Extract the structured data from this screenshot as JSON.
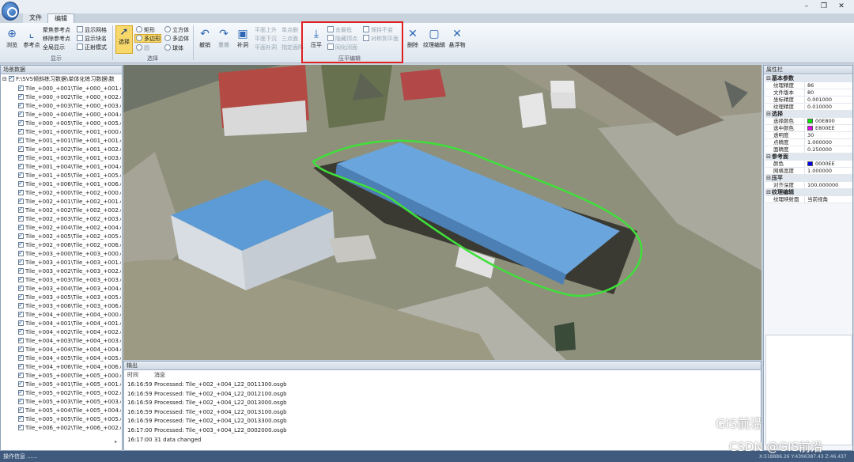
{
  "tabs": [
    {
      "label": "文件"
    },
    {
      "label": "编辑"
    }
  ],
  "window_controls": {
    "min": "–",
    "max": "❐",
    "close": "✕"
  },
  "ribbon": {
    "browse": "浏览",
    "ref_point": "参考点",
    "gather_ref": "聚焦参考点",
    "move_ref": "移除参考点",
    "global_show": "全局显示",
    "show_grid": "显示网格",
    "show_block": "显示块名",
    "orthographic": "正射模式",
    "group_display": "显示",
    "select": "选择",
    "rect": "矩形",
    "polygon": "多边形",
    "circle": "圆",
    "cube": "立方体",
    "polyhedron": "多边体",
    "sphere": "球体",
    "group_select": "选择",
    "undo": "撤销",
    "redo": "重做",
    "patch": "补洞",
    "smooth_up": "平面上升",
    "smooth_down": "平面下沉",
    "smooth_patch": "平面补洞",
    "delete_one": "单点删",
    "tri_one": "三点面",
    "project_down": "指定面降",
    "flatten": "压平",
    "keep_min": "去最低",
    "hide_vertex": "隐藏顶点",
    "preserve": "保持不变",
    "mirror_plane": "对称到平面",
    "lod_same": "同化闭面",
    "group_flatten": "压平编辑",
    "del": "删除",
    "texture_edit": "纹理编辑",
    "float": "悬浮物"
  },
  "left_panel": {
    "title": "场景数据",
    "root": "F:\\SVS倾斜练习数据\\单体化练习数据\\数",
    "items": [
      "Tile_+000_+001\\Tile_+000_+001.os",
      "Tile_+000_+002\\Tile_+000_+002.os",
      "Tile_+000_+003\\Tile_+000_+003.os",
      "Tile_+000_+004\\Tile_+000_+004.os",
      "Tile_+000_+005\\Tile_+000_+005.os",
      "Tile_+001_+000\\Tile_+001_+000.os",
      "Tile_+001_+001\\Tile_+001_+001.os",
      "Tile_+001_+002\\Tile_+001_+002.os",
      "Tile_+001_+003\\Tile_+001_+003.os",
      "Tile_+001_+004\\Tile_+001_+004.os",
      "Tile_+001_+005\\Tile_+001_+005.os",
      "Tile_+001_+006\\Tile_+001_+006.os",
      "Tile_+002_+000\\Tile_+002_+000.os",
      "Tile_+002_+001\\Tile_+002_+001.os",
      "Tile_+002_+002\\Tile_+002_+002.os",
      "Tile_+002_+003\\Tile_+002_+003.os",
      "Tile_+002_+004\\Tile_+002_+004.os",
      "Tile_+002_+005\\Tile_+002_+005.os",
      "Tile_+002_+006\\Tile_+002_+006.os",
      "Tile_+003_+000\\Tile_+003_+000.os",
      "Tile_+003_+001\\Tile_+003_+001.os",
      "Tile_+003_+002\\Tile_+003_+002.os",
      "Tile_+003_+003\\Tile_+003_+003.os",
      "Tile_+003_+004\\Tile_+003_+004.os",
      "Tile_+003_+005\\Tile_+003_+005.os",
      "Tile_+003_+006\\Tile_+003_+006.os",
      "Tile_+004_+000\\Tile_+004_+000.os",
      "Tile_+004_+001\\Tile_+004_+001.os",
      "Tile_+004_+002\\Tile_+004_+002.os",
      "Tile_+004_+003\\Tile_+004_+003.os",
      "Tile_+004_+004\\Tile_+004_+004.os",
      "Tile_+004_+005\\Tile_+004_+005.os",
      "Tile_+004_+006\\Tile_+004_+006.os",
      "Tile_+005_+000\\Tile_+005_+000.os",
      "Tile_+005_+001\\Tile_+005_+001.os",
      "Tile_+005_+002\\Tile_+005_+002.os",
      "Tile_+005_+003\\Tile_+005_+003.os",
      "Tile_+005_+004\\Tile_+005_+004.os",
      "Tile_+005_+005\\Tile_+005_+005.os",
      "Tile_+006_+002\\Tile_+006_+002.os"
    ]
  },
  "right_panel": {
    "title": "属性栏",
    "sections": [
      {
        "name": "基本参数",
        "rows": [
          {
            "k": "纹理精度",
            "v": "86"
          },
          {
            "k": "文件版本",
            "v": "80"
          },
          {
            "k": "坐标精度",
            "v": "0.001000"
          },
          {
            "k": "纹理精度",
            "v": "0.010000"
          }
        ]
      },
      {
        "name": "选择",
        "rows": [
          {
            "k": "选择颜色",
            "v": "00E800",
            "color": "#00e800"
          },
          {
            "k": "选中颜色",
            "v": "E800EE",
            "color": "#e800ee"
          },
          {
            "k": "透明度",
            "v": "30"
          },
          {
            "k": "点精度",
            "v": "1.000000"
          },
          {
            "k": "面精度",
            "v": "0.250000"
          }
        ]
      },
      {
        "name": "参考面",
        "rows": [
          {
            "k": "颜色",
            "v": "0000EE",
            "color": "#0000ee"
          },
          {
            "k": "网格宽度",
            "v": "1.000000"
          }
        ]
      },
      {
        "name": "压平",
        "rows": [
          {
            "k": "对齐深度",
            "v": "100.000000"
          }
        ]
      },
      {
        "name": "纹理编辑",
        "rows": [
          {
            "k": "纹理映射面",
            "v": "当前视角"
          }
        ]
      }
    ]
  },
  "output": {
    "title": "输出",
    "col_time": "时间",
    "col_msg": "消息",
    "rows": [
      {
        "t": "16:16:59",
        "m": "Processed: Tile_+002_+004_L22_0011300.osgb"
      },
      {
        "t": "16:16:59",
        "m": "Processed: Tile_+002_+004_L22_0012100.osgb"
      },
      {
        "t": "16:16:59",
        "m": "Processed: Tile_+002_+004_L22_0013000.osgb"
      },
      {
        "t": "16:16:59",
        "m": "Processed: Tile_+002_+004_L22_0013100.osgb"
      },
      {
        "t": "16:16:59",
        "m": "Processed: Tile_+002_+004_L22_0013300.osgb"
      },
      {
        "t": "16:17:00",
        "m": "Processed: Tile_+003_+004_L22_0002000.osgb"
      },
      {
        "t": "16:17:00",
        "m": "31 data changed"
      }
    ]
  },
  "status": "操作信息 ......",
  "coord": "X:518886.26 Y:4396387.43 Z:46.437",
  "watermark": {
    "line1": "GIS前沿",
    "line2": "CSDN @GIS前沿"
  },
  "colors": {
    "selection_green": "#3fe03a",
    "roof_blue": "#5d9bd6",
    "ribbon_highlight": "#f7d86b",
    "annotation_red": "#e02020"
  }
}
